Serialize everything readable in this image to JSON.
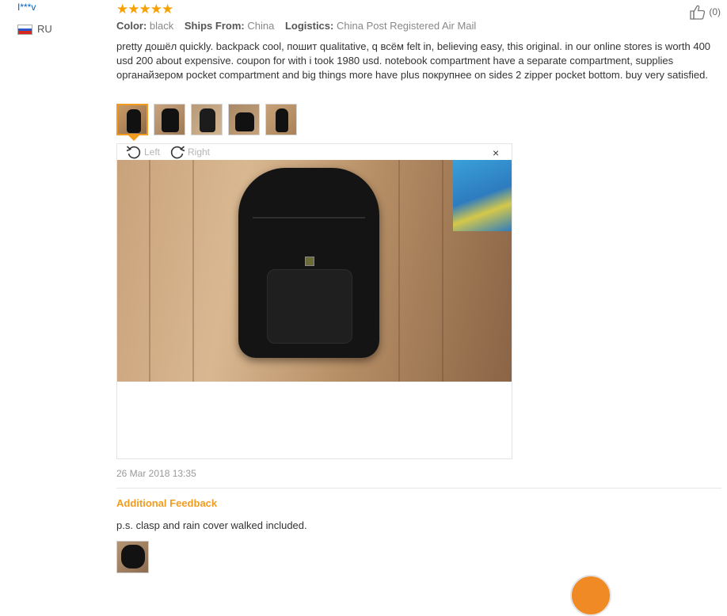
{
  "user": {
    "name": "I***v",
    "country": "RU",
    "flag_colors": [
      "#ffffff",
      "#2f58c7",
      "#d52b1e"
    ]
  },
  "rating": {
    "stars": "★★★★★",
    "value": 5,
    "color": "#f6a100"
  },
  "helpful": {
    "count": "(0)",
    "icon": "thumbs-up-icon"
  },
  "meta": {
    "color_label": "Color:",
    "color_value": "black",
    "ships_label": "Ships From:",
    "ships_value": "China",
    "logistics_label": "Logistics:",
    "logistics_value": "China Post Registered Air Mail"
  },
  "review_text": "pretty дошёл quickly. backpack cool, пошит qualitative, q всём felt in, believing easy, this original. in our online stores is worth 400 usd 200 about expensive. coupon for with i took 1980 usd. notebook compartment have a separate compartment, supplies органайзером pocket compartment and big things more have plus покрупнее on sides 2 zipper pocket bottom. buy very satisfied.",
  "thumbnails": [
    {
      "name": "review-photo-1",
      "active": true
    },
    {
      "name": "review-photo-2",
      "active": false
    },
    {
      "name": "review-photo-3",
      "active": false
    },
    {
      "name": "review-photo-4",
      "active": false
    },
    {
      "name": "review-photo-5",
      "active": false
    }
  ],
  "viewer": {
    "rotate_left_label": "Left",
    "rotate_right_label": "Right",
    "close_label": "×"
  },
  "date": "26 Mar 2018 13:35",
  "additional_feedback": {
    "title": "Additional Feedback",
    "text": "p.s. clasp and rain cover walked included."
  },
  "accent_color": "#f29c1f"
}
